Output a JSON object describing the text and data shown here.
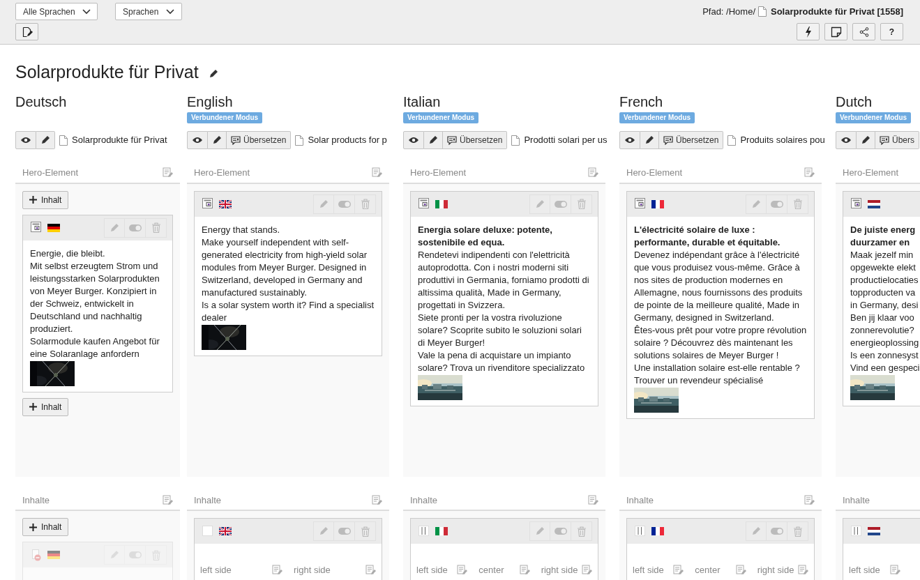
{
  "toolbar": {
    "language_select": "Alle Sprachen",
    "view_select": "Sprachen",
    "path_label": "Pfad: /Home/",
    "path_page": "Solarprodukte für Privat [1558]",
    "help_label": "?"
  },
  "page_title": "Solarprodukte für Privat",
  "languages": [
    {
      "name": "Deutsch",
      "page_title": "Solarprodukte für Privat",
      "hero": {
        "label": "Hero-Element",
        "add_top": "Inhalt",
        "add_bottom": "Inhalt",
        "card": {
          "flag": {
            "kind": "de"
          },
          "hidden": false,
          "paragraphs": [
            {
              "text": "Energie, die bleibt.",
              "bold": false
            },
            {
              "text": "Mit selbst erzeugtem Strom und leistungsstarken Solarprodukten von Meyer Burger. Konzipiert in der Schweiz, entwickelt in Deutschland und nachhaltig produziert.",
              "bold": false
            },
            {
              "text": "Solarmodule kaufen Angebot für eine Solaranlage anfordern",
              "bold": false
            }
          ]
        }
      },
      "content": {
        "label": "Inhalte",
        "add_top": "Inhalt",
        "card": {
          "flag": {
            "kind": "de"
          },
          "hidden": true,
          "icon": {
            "kind": "plain"
          }
        }
      }
    },
    {
      "name": "English",
      "badge": "Verbundener Modus",
      "translate": "Übersetzen",
      "page_title": "Solar products for p",
      "hero": {
        "label": "Hero-Element",
        "card": {
          "flag": {
            "kind": "gb"
          },
          "hidden": false,
          "paragraphs": [
            {
              "text": "Energy that stands.",
              "bold": false
            },
            {
              "text": "Make yourself independent with self-generated electricity from high-yield solar modules from Meyer Burger. Designed in Switzerland, developed in Germany and manufactured sustainably.",
              "bold": false
            },
            {
              "text": "Is a solar system worth it? Find a specialist dealer",
              "bold": false
            }
          ]
        }
      },
      "content": {
        "label": "Inhalte",
        "card": {
          "flag": {
            "kind": "gb"
          },
          "hidden": false,
          "icon": {
            "kind": "box"
          },
          "columns": [
            "left side",
            "right side"
          ]
        }
      }
    },
    {
      "name": "Italian",
      "badge": "Verbundener Modus",
      "translate": "Übersetzen",
      "page_title": "Prodotti solari per us",
      "hero": {
        "label": "Hero-Element",
        "card": {
          "flag": {
            "kind": "it"
          },
          "hidden": false,
          "paragraphs": [
            {
              "text": "Energia solare deluxe: potente, sostenibile ed equa.",
              "bold": true
            },
            {
              "text": "Rendetevi indipendenti con l'elettricità autoprodotta. Con i nostri moderni siti produttivi in Germania, forniamo prodotti di altissima qualità, Made in Germany, progettati in Svizzera.",
              "bold": false
            },
            {
              "text": "Siete pronti per la vostra rivoluzione solare? Scoprite subito le soluzioni solari di Meyer Burger!",
              "bold": false
            },
            {
              "text": "Vale la pena di acquistare un impianto solare? Trova un rivenditore specializzato",
              "bold": false
            }
          ]
        }
      },
      "content": {
        "label": "Inhalte",
        "card": {
          "flag": {
            "kind": "it"
          },
          "hidden": false,
          "icon": {
            "kind": "columns"
          },
          "columns": [
            "left side",
            "center",
            "right side"
          ]
        }
      }
    },
    {
      "name": "French",
      "badge": "Verbundener Modus",
      "translate": "Übersetzen",
      "page_title": "Produits solaires pou",
      "hero": {
        "label": "Hero-Element",
        "card": {
          "flag": {
            "kind": "fr"
          },
          "hidden": false,
          "paragraphs": [
            {
              "text": "L'électricité solaire de luxe : performante, durable et équitable.",
              "bold": true
            },
            {
              "text": "Devenez indépendant grâce à l'électricité que vous produisez vous-même. Grâce à nos sites de production modernes en Allemagne, nous fournissons des produits de pointe de la meilleure qualité, Made in Germany, designed in Switzerland.",
              "bold": false
            },
            {
              "text": "Êtes-vous prêt pour votre propre révolution solaire ? Découvrez dès maintenant les solutions solaires de Meyer Burger !",
              "bold": false
            },
            {
              "text": "Une installation solaire est-elle rentable ? Trouver un revendeur spécialisé",
              "bold": false
            }
          ]
        }
      },
      "content": {
        "label": "Inhalte",
        "card": {
          "flag": {
            "kind": "fr"
          },
          "hidden": false,
          "icon": {
            "kind": "columns"
          },
          "columns": [
            "left side",
            "center",
            "right side"
          ]
        }
      }
    },
    {
      "name": "Dutch",
      "badge": "Verbundener Modus",
      "translate": "Übers",
      "hero": {
        "label": "Hero-Element",
        "card": {
          "flag": {
            "kind": "nl"
          },
          "hidden": false,
          "paragraphs": [
            {
              "text": "De juiste energ",
              "bold": true
            },
            {
              "text": "duurzamer en",
              "bold": true
            },
            {
              "text": "Maak jezelf min",
              "bold": false
            },
            {
              "text": "opgewekte elekt",
              "bold": false
            },
            {
              "text": "productielocaties",
              "bold": false
            },
            {
              "text": "topproducten va",
              "bold": false
            },
            {
              "text": "in Germany, desi",
              "bold": false
            },
            {
              "text": "Ben jij klaar voo",
              "bold": false
            },
            {
              "text": "zonnerevolutie?",
              "bold": false
            },
            {
              "text": "energieoplossing",
              "bold": false
            },
            {
              "text": "Is een zonnesyst",
              "bold": false
            },
            {
              "text": "Vind een gespeci",
              "bold": false
            }
          ]
        }
      },
      "content": {
        "label": "Inhalte",
        "card": {
          "flag": {
            "kind": "nl"
          },
          "hidden": false,
          "icon": {
            "kind": "columns"
          },
          "columns": [
            "left side"
          ]
        }
      }
    }
  ]
}
